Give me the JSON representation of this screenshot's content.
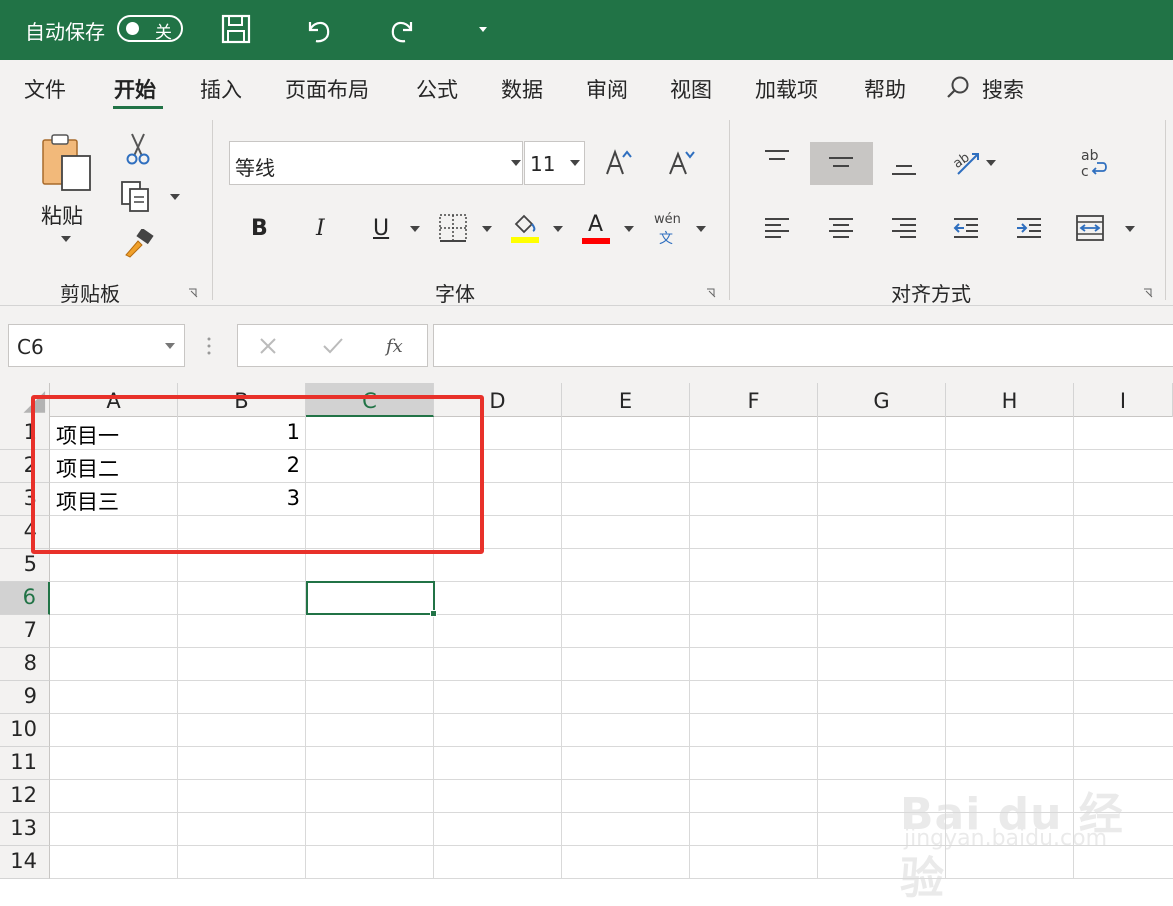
{
  "titlebar": {
    "autosave_label": "自动保存",
    "autosave_state": "关",
    "icons": [
      "save-icon",
      "undo-icon",
      "redo-icon",
      "customize-dropdown-icon"
    ]
  },
  "menu": {
    "tabs": [
      {
        "label": "文件",
        "active": false
      },
      {
        "label": "开始",
        "active": true
      },
      {
        "label": "插入",
        "active": false
      },
      {
        "label": "页面布局",
        "active": false
      },
      {
        "label": "公式",
        "active": false
      },
      {
        "label": "数据",
        "active": false
      },
      {
        "label": "审阅",
        "active": false
      },
      {
        "label": "视图",
        "active": false
      },
      {
        "label": "加载项",
        "active": false
      },
      {
        "label": "帮助",
        "active": false
      }
    ],
    "search_label": "搜索"
  },
  "ribbon": {
    "clipboard": {
      "paste_label": "粘贴",
      "group_label": "剪贴板"
    },
    "font": {
      "font_name": "等线",
      "font_size": "11",
      "group_label": "字体",
      "bold": "B",
      "italic": "I",
      "underline": "U",
      "font_color_letter": "A",
      "phonetic_top": "wén",
      "phonetic_bottom": "文",
      "fill_color": "#ffff00",
      "font_color": "#ff0000"
    },
    "alignment": {
      "group_label": "对齐方式",
      "wrap_text_label": "ab c"
    }
  },
  "formulabar": {
    "namebox": "C6",
    "formula": ""
  },
  "sheet": {
    "columns": [
      "A",
      "B",
      "C",
      "D",
      "E",
      "F",
      "G",
      "H",
      "I"
    ],
    "rows": [
      "1",
      "2",
      "3",
      "4",
      "5",
      "6",
      "7",
      "8",
      "9",
      "10",
      "11",
      "12",
      "13",
      "14"
    ],
    "selected_column": "C",
    "selected_row": "6",
    "cells": {
      "A1": "项目一",
      "B1": "1",
      "A2": "项目二",
      "B2": "2",
      "A3": "项目三",
      "B3": "3"
    }
  },
  "watermark": {
    "brand": "Bai du 经验",
    "url": "jingyan.baidu.com"
  },
  "colors": {
    "accent": "#217346",
    "highlight": "#e8312a"
  }
}
